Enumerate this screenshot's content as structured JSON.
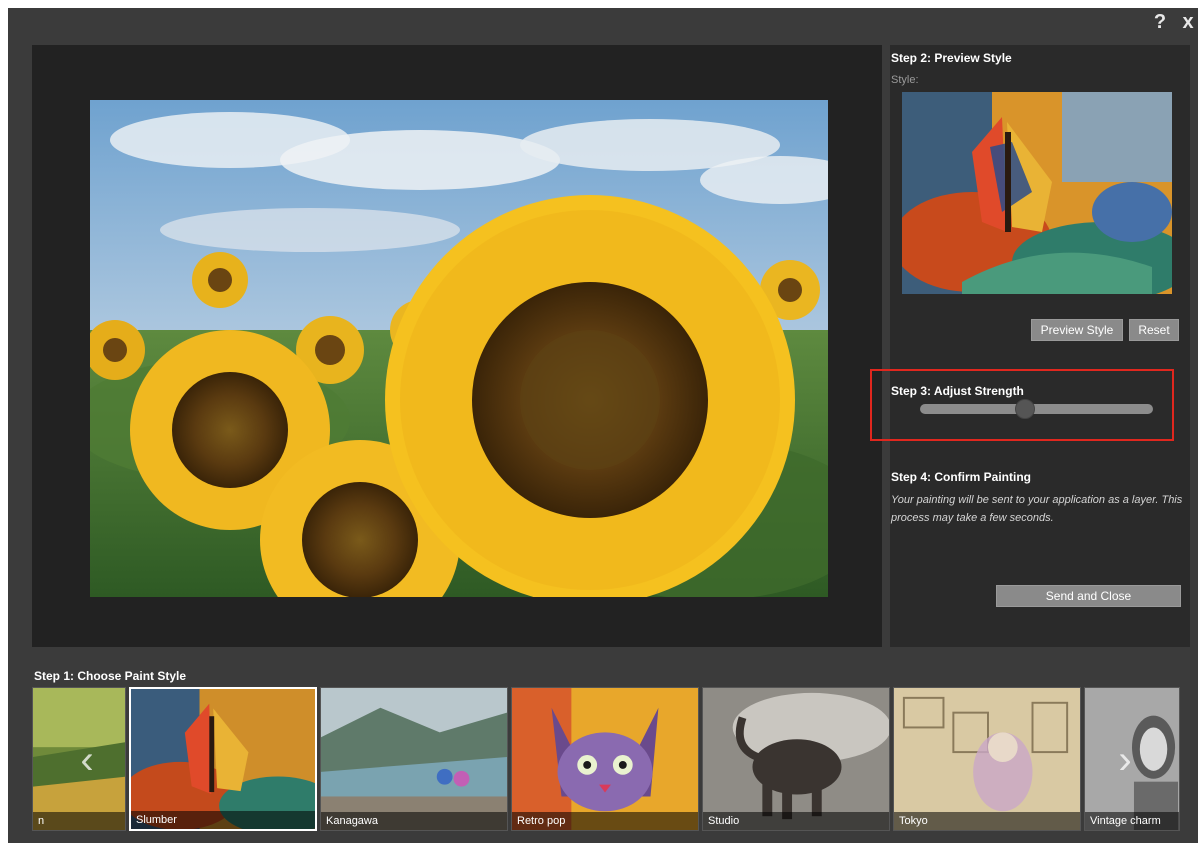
{
  "window": {
    "help_label": "?",
    "close_label": "x"
  },
  "preview": {
    "image": "sunflower-painting"
  },
  "step2": {
    "title": "Step 2: Preview Style",
    "style_label": "Style:",
    "preview_button": "Preview Style",
    "reset_button": "Reset"
  },
  "step3": {
    "title": "Step 3: Adjust Strength",
    "strength": 0.45
  },
  "step4": {
    "title": "Step 4: Confirm Painting",
    "description": "Your painting will be sent to your application as a layer. This process may take a few seconds.",
    "send_button": "Send and Close"
  },
  "step1": {
    "title": "Step 1: Choose Paint Style",
    "thumbnails": [
      {
        "label": "n"
      },
      {
        "label": "Slumber",
        "selected": true
      },
      {
        "label": "Kanagawa"
      },
      {
        "label": "Retro pop"
      },
      {
        "label": "Studio"
      },
      {
        "label": "Tokyo"
      },
      {
        "label": "Vintage charm"
      }
    ]
  },
  "icons": {
    "prev": "chevron-left-icon",
    "next": "chevron-right-icon"
  },
  "colors": {
    "highlight": "#e0271e",
    "button": "#8a8a8a",
    "panel": "#2a2a2a"
  }
}
